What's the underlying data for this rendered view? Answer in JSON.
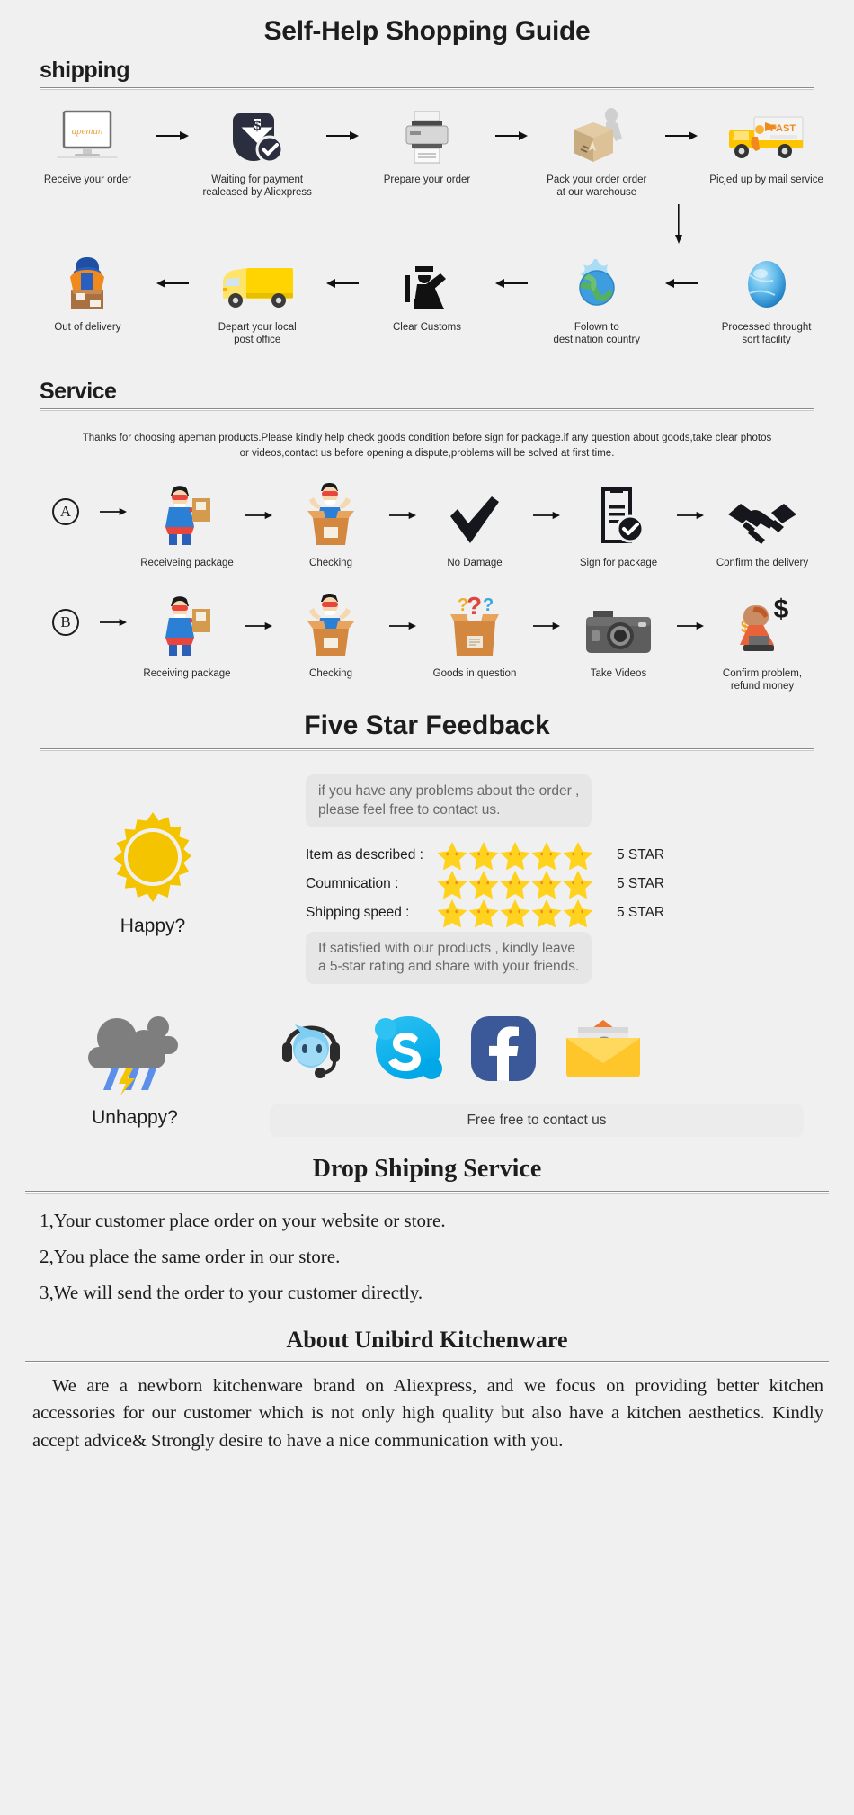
{
  "page": {
    "main_title": "Self-Help Shopping Guide"
  },
  "shipping": {
    "heading": "shipping",
    "row1": [
      {
        "label": "Receive your order",
        "icon": "monitor-apeman-icon"
      },
      {
        "label": "Waiting for payment\nrealeased by Aliexpress",
        "icon": "payment-shield-icon"
      },
      {
        "label": "Prepare your order",
        "icon": "printer-icon"
      },
      {
        "label": "Pack your order order\nat our warehouse",
        "icon": "packing-box-icon"
      },
      {
        "label": "Picjed up by mail service",
        "icon": "delivery-truck-fast-icon"
      }
    ],
    "row2": [
      {
        "label": "Out of delivery",
        "icon": "courier-with-box-icon"
      },
      {
        "label": "Depart your local\npost office",
        "icon": "yellow-van-icon"
      },
      {
        "label": "Clear Customs",
        "icon": "customs-officer-icon"
      },
      {
        "label": "Folown to\ndestination country",
        "icon": "globe-splash-icon"
      },
      {
        "label": "Processed throught\nsort facility",
        "icon": "blue-globe-icon"
      }
    ]
  },
  "service": {
    "heading": "Service",
    "note": "Thanks for choosing apeman products.Please kindly help check goods condition before sign for package.if any question about goods,take clear photos or videos,contact us before opening a dispute,problems will be solved at first time.",
    "rowA": {
      "letter": "A",
      "steps": [
        {
          "label": "Receiveing package",
          "icon": "hero-holding-package-icon"
        },
        {
          "label": "Checking",
          "icon": "hero-in-open-box-icon"
        },
        {
          "label": "No Damage",
          "icon": "check-mark-icon"
        },
        {
          "label": "Sign for package",
          "icon": "signed-document-icon"
        },
        {
          "label": "Confirm the delivery",
          "icon": "handshake-icon"
        }
      ]
    },
    "rowB": {
      "letter": "B",
      "steps": [
        {
          "label": "Receiving package",
          "icon": "hero-holding-package-icon"
        },
        {
          "label": "Checking",
          "icon": "hero-in-open-box-icon"
        },
        {
          "label": "Goods in question",
          "icon": "question-box-icon"
        },
        {
          "label": "Take Videos",
          "icon": "camera-icon"
        },
        {
          "label": "Confirm problem,\nrefund money",
          "icon": "refund-agent-icon"
        }
      ]
    }
  },
  "feedback": {
    "title": "Five Star Feedback",
    "happy_label": "Happy?",
    "happy_icon": "sun-icon",
    "bubble_top": "if you have any problems about the order ,\nplease feel free to contact us.",
    "bubble_bottom": "If satisfied with our products ,  kindly leave\na 5-star rating and share with your friends.",
    "ratings": [
      {
        "name": "Item as described :",
        "stars": 5,
        "value": "5 STAR"
      },
      {
        "name": "Coumnication :",
        "stars": 5,
        "value": "5 STAR"
      },
      {
        "name": "Shipping speed :",
        "stars": 5,
        "value": "5 STAR"
      }
    ],
    "unhappy_label": "Unhappy?",
    "unhappy_icon": "rain-cloud-icon",
    "contact_icons": [
      "trademanager-support-icon",
      "skype-icon",
      "facebook-icon",
      "email-envelope-icon"
    ],
    "contact_bar": "Free free to contact us"
  },
  "dropship": {
    "title": "Drop Shiping Service",
    "items": [
      "1,Your customer place order on your website or store.",
      "2,You place the same order in our store.",
      "3,We will send the order to your customer directly."
    ]
  },
  "about": {
    "title": "About Unibird Kitchenware",
    "text": "We are a newborn kitchenware brand on Aliexpress, and we focus on providing better kitchen accessories for our customer which is not only high quality but also have a kitchen aesthetics. Kindly accept advice& Strongly desire to have a nice communication with you."
  },
  "colors": {
    "bg": "#f0f0f0",
    "star_yellow": "#FFD21E",
    "sun_yellow": "#F5C400",
    "skype_blue": "#00AFF0",
    "facebook_blue": "#3B5998",
    "envelope_yellow": "#FFC62C",
    "truck_yellow": "#FFD400",
    "cloud_grey": "#7E7E7E"
  }
}
